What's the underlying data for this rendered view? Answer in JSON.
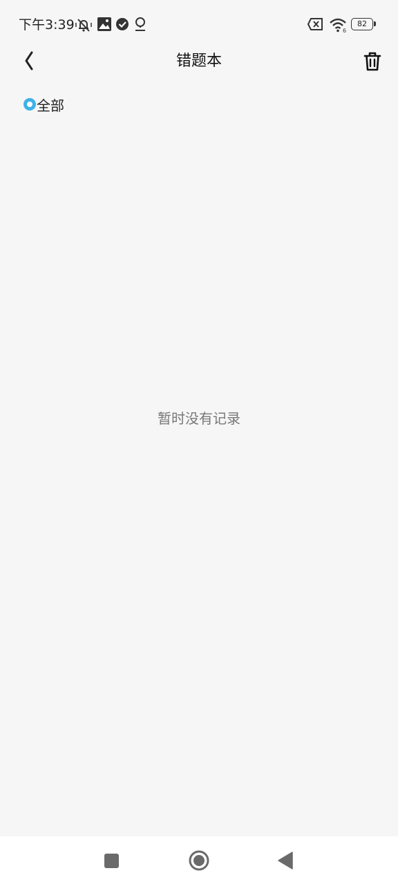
{
  "status_bar": {
    "time": "下午3:39",
    "battery": "82",
    "icons": [
      "mute-bell-icon",
      "gallery-icon",
      "check-circle-icon",
      "location-icon",
      "sim-x-icon",
      "wifi-icon"
    ]
  },
  "header": {
    "title": "错题本",
    "back_icon": "chevron-left-icon",
    "delete_icon": "trash-icon"
  },
  "filter": {
    "label": "全部",
    "selected": true,
    "accent_color": "#3db2e8"
  },
  "empty_state": {
    "text": "暂时没有记录"
  },
  "nav_bar": {
    "icons": [
      "recents-square-icon",
      "home-circle-icon",
      "back-triangle-icon"
    ]
  }
}
